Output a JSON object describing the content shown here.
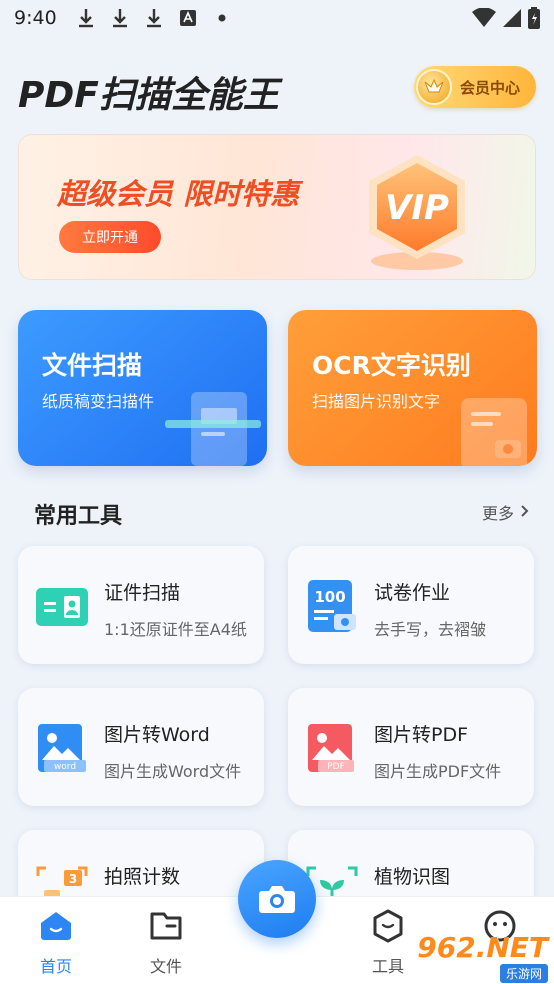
{
  "status_bar": {
    "time": "9:40"
  },
  "header": {
    "title": "PDF扫描全能王",
    "member_label": "会员中心"
  },
  "banner": {
    "headline": "超级会员 限时特惠",
    "cta_label": "立即开通",
    "badge_text": "VIP"
  },
  "feature_cards": [
    {
      "title": "文件扫描",
      "subtitle": "纸质稿变扫描件"
    },
    {
      "title": "OCR文字识别",
      "subtitle": "扫描图片识别文字"
    }
  ],
  "tools_section": {
    "title": "常用工具",
    "more_label": "更多"
  },
  "tools": [
    {
      "title": "证件扫描",
      "subtitle": "1:1还原证件至A4纸"
    },
    {
      "title": "试卷作业",
      "subtitle": "去手写，去褶皱",
      "icon_text": "100"
    },
    {
      "title": "图片转Word",
      "subtitle": "图片生成Word文件",
      "icon_text": "word"
    },
    {
      "title": "图片转PDF",
      "subtitle": "图片生成PDF文件",
      "icon_text": "PDF"
    },
    {
      "title": "拍照计数",
      "subtitle": "",
      "icon_text": "3"
    },
    {
      "title": "植物识图",
      "subtitle": ""
    }
  ],
  "bottom_nav": [
    {
      "label": "首页",
      "active": true
    },
    {
      "label": "文件",
      "active": false
    },
    {
      "label": "工具",
      "active": false
    },
    {
      "label": "",
      "active": false
    }
  ],
  "watermark": {
    "brand": "962.NET",
    "sub": "乐游网"
  },
  "colors": {
    "accent_blue": "#2e86f5",
    "accent_orange": "#ff7b1e",
    "banner_red": "#ef4d23"
  }
}
